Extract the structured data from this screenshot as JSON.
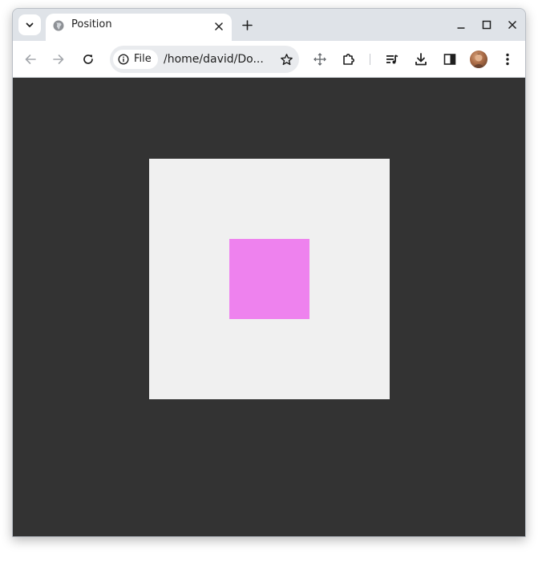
{
  "tab": {
    "title": "Position",
    "favicon": "globe-icon"
  },
  "toolbar": {
    "site_chip_label": "File",
    "url": "/home/david/Do..."
  },
  "icons": {
    "tab_search": "chevron-down-icon",
    "tab_close": "close-icon",
    "new_tab": "plus-icon",
    "minimize": "minimize-icon",
    "maximize": "maximize-icon",
    "close_window": "close-icon",
    "back": "back-arrow-icon",
    "forward": "forward-arrow-icon",
    "reload": "reload-icon",
    "site_info": "info-icon",
    "bookmark": "star-icon",
    "move": "move-icon",
    "extensions": "puzzle-icon",
    "media": "media-queue-icon",
    "downloads": "download-icon",
    "side_panel": "side-panel-icon",
    "menu": "kebab-menu-icon"
  },
  "colors": {
    "page_background": "#333333",
    "container_background": "#f0f0f0",
    "square_color": "#ee82ee"
  }
}
